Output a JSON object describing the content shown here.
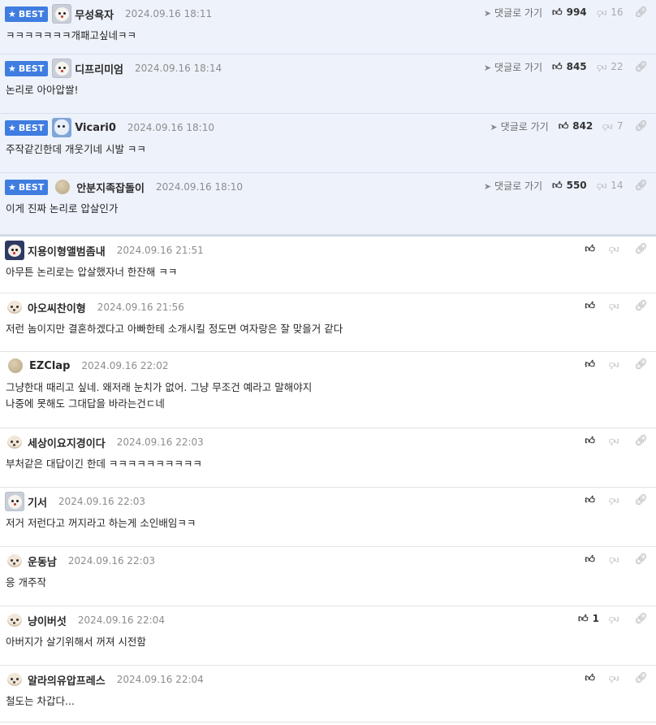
{
  "labels": {
    "best": "BEST",
    "reply_link": "댓글로 가기"
  },
  "colors": {
    "best_badge": "#3f7de0",
    "best_background": "#eef2fb"
  },
  "comments": [
    {
      "best": true,
      "avatar": "white-dog-avatar",
      "nick": "무성욕자",
      "date": "2024.09.16 18:11",
      "likes": "994",
      "dislikes": "16",
      "text": [
        "ㅋㅋㅋㅋㅋㅋㅋ개패고싶네ㅋㅋ"
      ]
    },
    {
      "best": true,
      "avatar": "white-blue-avatar",
      "nick": "디프리미엄",
      "date": "2024.09.16 18:14",
      "likes": "845",
      "dislikes": "22",
      "text": [
        "논리로 아아압쌀!"
      ]
    },
    {
      "best": true,
      "avatar": "blue-avatar",
      "nick": "Vicari0",
      "date": "2024.09.16 18:10",
      "likes": "842",
      "dislikes": "7",
      "text": [
        "주작같긴한데 개웃기네 시발 ㅋㅋ"
      ]
    },
    {
      "best": true,
      "avatar": "blob-avatar",
      "nick": "안분지족잡돌이",
      "date": "2024.09.16 18:10",
      "likes": "550",
      "dislikes": "14",
      "text": [
        "이게 진짜 논리로 압살인가"
      ]
    },
    {
      "best": false,
      "avatar": "dark-avatar",
      "nick": "지용이형앨범좀내",
      "date": "2024.09.16 21:51",
      "likes": "",
      "dislikes": "",
      "text": [
        "아무튼 논리로는 압살했자너 한잔해 ㅋㅋ"
      ]
    },
    {
      "best": false,
      "avatar": "dog-avatar",
      "nick": "아오씨찬이형",
      "date": "2024.09.16 21:56",
      "likes": "",
      "dislikes": "",
      "text": [
        "저런 놈이지만 결혼하겠다고 아빠한테 소개시킬 정도면 여자랑은 잘 맞을거 같다"
      ]
    },
    {
      "best": false,
      "avatar": "blob-avatar",
      "nick": "EZClap",
      "date": "2024.09.16 22:02",
      "likes": "",
      "dislikes": "",
      "text": [
        "그냥한대 때리고 싶네. 왜저래 눈치가 없어. 그냥 무조건 예라고 말해야지",
        "나중에 못해도 그대답을 바라는건ㄷ네"
      ]
    },
    {
      "best": false,
      "avatar": "dog-avatar",
      "nick": "세상이요지경이다",
      "date": "2024.09.16 22:03",
      "likes": "",
      "dislikes": "",
      "text": [
        "부처같은 대답이긴 한데 ㅋㅋㅋㅋㅋㅋㅋㅋㅋㅋ"
      ]
    },
    {
      "best": false,
      "avatar": "white-dog-avatar",
      "nick": "기서",
      "date": "2024.09.16 22:03",
      "likes": "",
      "dislikes": "",
      "text": [
        "저거 저런다고 꺼지라고 하는게 소인배임ㅋㅋ"
      ]
    },
    {
      "best": false,
      "avatar": "dog-avatar",
      "nick": "운동남",
      "date": "2024.09.16 22:03",
      "likes": "",
      "dislikes": "",
      "text": [
        "응 개주작"
      ]
    },
    {
      "best": false,
      "avatar": "dog-avatar",
      "nick": "냥이버섯",
      "date": "2024.09.16 22:04",
      "likes": "1",
      "dislikes": "",
      "text": [
        "아버지가 살기위해서 꺼져 시전함"
      ]
    },
    {
      "best": false,
      "avatar": "dog-avatar",
      "nick": "알라의유압프레스",
      "date": "2024.09.16 22:04",
      "likes": "",
      "dislikes": "",
      "text": [
        "철도는 차갑다..."
      ]
    }
  ]
}
